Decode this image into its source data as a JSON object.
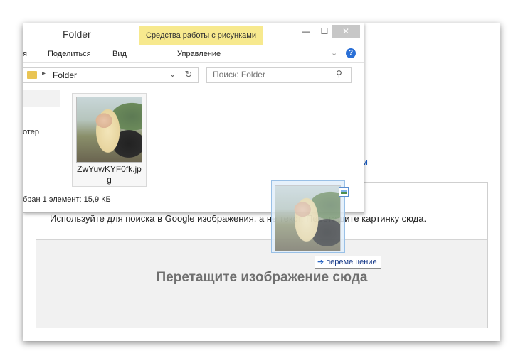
{
  "background": {
    "partial_link": "м"
  },
  "google_panel": {
    "hint": "Используйте для поиска в Google изображения, а не текст. Перетащите картинку сюда.",
    "drop_text": "Перетащите изображение сюда"
  },
  "explorer": {
    "title": "Folder",
    "context_tab": "Средства работы с рисунками",
    "window_buttons": {
      "minimize": "—",
      "maximize": "☐",
      "close": "✕"
    },
    "ribbon": {
      "tabs": [
        "я",
        "Поделиться",
        "Вид",
        "Управление"
      ],
      "help": "?"
    },
    "address": {
      "path": "Folder",
      "separator": "▸",
      "dropdown": "⌄",
      "refresh": "↻"
    },
    "search": {
      "placeholder": "Поиск: Folder",
      "icon": "search-icon"
    },
    "nav_item": "отер",
    "file": {
      "name_line1": "ZwYuwKYF0fk.jp",
      "name_line2": "g"
    },
    "status": "бран 1 элемент: 15,9 КБ"
  },
  "drag": {
    "tooltip": "перемещение",
    "tooltip_icon": "move-arrow-icon"
  },
  "colors": {
    "context_tab": "#f7e98e",
    "close_button": "#c7c7c7",
    "accent_blue": "#2a6fd6",
    "drag_ghost": "#e2eefa"
  }
}
